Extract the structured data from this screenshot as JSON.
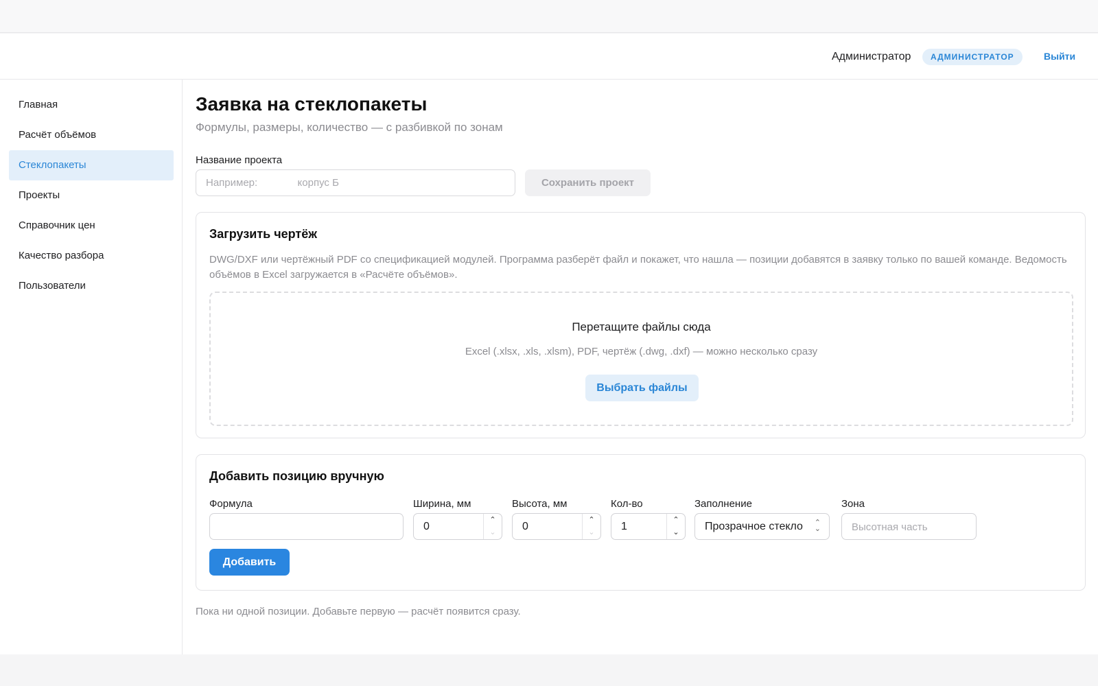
{
  "header": {
    "user_name": "Администратор",
    "role_badge": "АДМИНИСТРАТОР",
    "logout_label": "Выйти"
  },
  "sidebar": {
    "items": [
      {
        "label": "Главная",
        "active": false
      },
      {
        "label": "Расчёт объёмов",
        "active": false
      },
      {
        "label": "Стеклопакеты",
        "active": true
      },
      {
        "label": "Проекты",
        "active": false
      },
      {
        "label": "Справочник цен",
        "active": false
      },
      {
        "label": "Качество разбора",
        "active": false
      },
      {
        "label": "Пользователи",
        "active": false
      }
    ]
  },
  "page": {
    "title": "Заявка на стеклопакеты",
    "subtitle": "Формулы, размеры, количество — с разбивкой по зонам"
  },
  "project": {
    "label": "Название проекта",
    "placeholder": "Например:              корпус Б",
    "value": "",
    "save_label": "Сохранить проект"
  },
  "upload": {
    "title": "Загрузить чертёж",
    "description": "DWG/DXF или чертёжный PDF со спецификацией модулей. Программа разберёт файл и покажет, что нашла — позиции добавятся в заявку только по вашей команде. Ведомость объёмов в Excel загружается в «Расчёте объёмов».",
    "drop_title": "Перетащите файлы сюда",
    "drop_hint": "Excel (.xlsx, .xls, .xlsm), PDF, чертёж (.dwg, .dxf) — можно несколько сразу",
    "choose_label": "Выбрать файлы"
  },
  "manual": {
    "title": "Добавить позицию вручную",
    "formula_label": "Формула",
    "formula_value": "",
    "width_label": "Ширина, мм",
    "width_value": "0",
    "height_label": "Высота, мм",
    "height_value": "0",
    "qty_label": "Кол-во",
    "qty_value": "1",
    "fill_label": "Заполнение",
    "fill_value": "Прозрачное стекло",
    "zone_label": "Зона",
    "zone_placeholder": "Высотная часть",
    "add_label": "Добавить"
  },
  "empty_note": "Пока ни одной позиции. Добавьте первую — расчёт появится сразу.",
  "icons": {
    "spin_up": "▲ chevron-up",
    "spin_down": "▼ chevron-down",
    "select_arrows": "updown-chevrons"
  },
  "colors": {
    "accent": "#2a86e0",
    "accent_soft": "#e3effa",
    "muted_text": "#8b8b90"
  }
}
